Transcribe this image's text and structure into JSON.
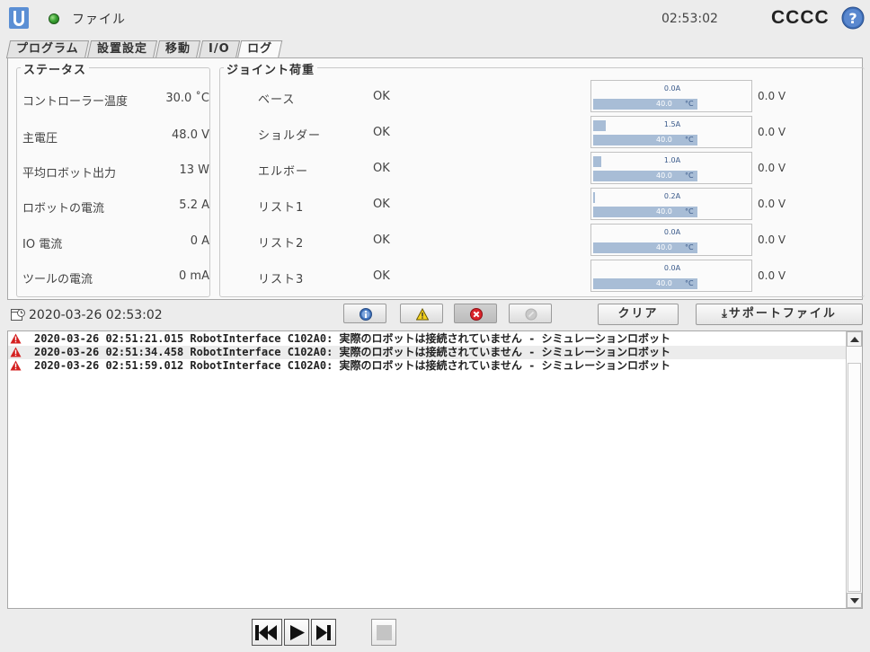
{
  "header": {
    "menu_label": "ファイル",
    "time": "02:53:02",
    "robot_name": "CCCC",
    "status_color": "#3aa233",
    "icons": {
      "logo": "universal-robots-logo",
      "help": "help-icon"
    }
  },
  "tabs": [
    {
      "label": "プログラム",
      "active": false
    },
    {
      "label": "設置設定",
      "active": false
    },
    {
      "label": "移動",
      "active": false
    },
    {
      "label": "I/O",
      "active": false
    },
    {
      "label": "ログ",
      "active": true
    }
  ],
  "status": {
    "title": "ステータス",
    "rows": [
      {
        "label": "コントローラー温度",
        "value": "30.0 ˚C"
      },
      {
        "label": "主電圧",
        "value": "48.0  V"
      },
      {
        "label": "平均ロボット出力",
        "value": "13  W"
      },
      {
        "label": "ロボットの電流",
        "value": "5.2  A"
      },
      {
        "label": "IO 電流",
        "value": "0  A"
      },
      {
        "label": "ツールの電流",
        "value": "0 mA"
      }
    ]
  },
  "joints": {
    "title": "ジョイント荷重",
    "rows": [
      {
        "name": "ベース",
        "status": "OK",
        "current": "0.0A",
        "current_level": 0.0,
        "temp": "40.0",
        "temp_unit": "°C",
        "voltage": "0.0 V"
      },
      {
        "name": "ショルダー",
        "status": "OK",
        "current": "1.5A",
        "current_level": 0.08,
        "temp": "40.0",
        "temp_unit": "°C",
        "voltage": "0.0 V"
      },
      {
        "name": "エルボー",
        "status": "OK",
        "current": "1.0A",
        "current_level": 0.05,
        "temp": "40.0",
        "temp_unit": "°C",
        "voltage": "0.0 V"
      },
      {
        "name": "リスト1",
        "status": "OK",
        "current": "0.2A",
        "current_level": 0.012,
        "temp": "40.0",
        "temp_unit": "°C",
        "voltage": "0.0 V"
      },
      {
        "name": "リスト2",
        "status": "OK",
        "current": "0.0A",
        "current_level": 0.0,
        "temp": "40.0",
        "temp_unit": "°C",
        "voltage": "0.0 V"
      },
      {
        "name": "リスト3",
        "status": "OK",
        "current": "0.0A",
        "current_level": 0.0,
        "temp": "40.0",
        "temp_unit": "°C",
        "voltage": "0.0 V"
      }
    ]
  },
  "log_toolbar": {
    "timestamp": "2020-03-26 02:53:02",
    "clear_label": "クリア",
    "support_file_label": "⤓サポートファイル",
    "filters": [
      {
        "icon": "info-icon",
        "pressed": false
      },
      {
        "icon": "warning-icon",
        "pressed": false
      },
      {
        "icon": "error-icon",
        "pressed": true
      },
      {
        "icon": "disabled-icon",
        "pressed": false
      }
    ]
  },
  "log": {
    "entries": [
      {
        "icon": "warning-icon",
        "text": "2020-03-26 02:51:21.015 RobotInterface C102A0: 実際のロボットは接続されていません - シミュレーションロボット"
      },
      {
        "icon": "warning-icon",
        "text": "2020-03-26 02:51:34.458 RobotInterface C102A0: 実際のロボットは接続されていません - シミュレーションロボット"
      },
      {
        "icon": "warning-icon",
        "text": "2020-03-26 02:51:59.012 RobotInterface C102A0: 実際のロボットは接続されていません - シミュレーションロボット"
      }
    ]
  },
  "playback": {
    "buttons": [
      "skip-to-start-icon",
      "play-icon",
      "step-forward-icon",
      "stop-icon"
    ]
  }
}
